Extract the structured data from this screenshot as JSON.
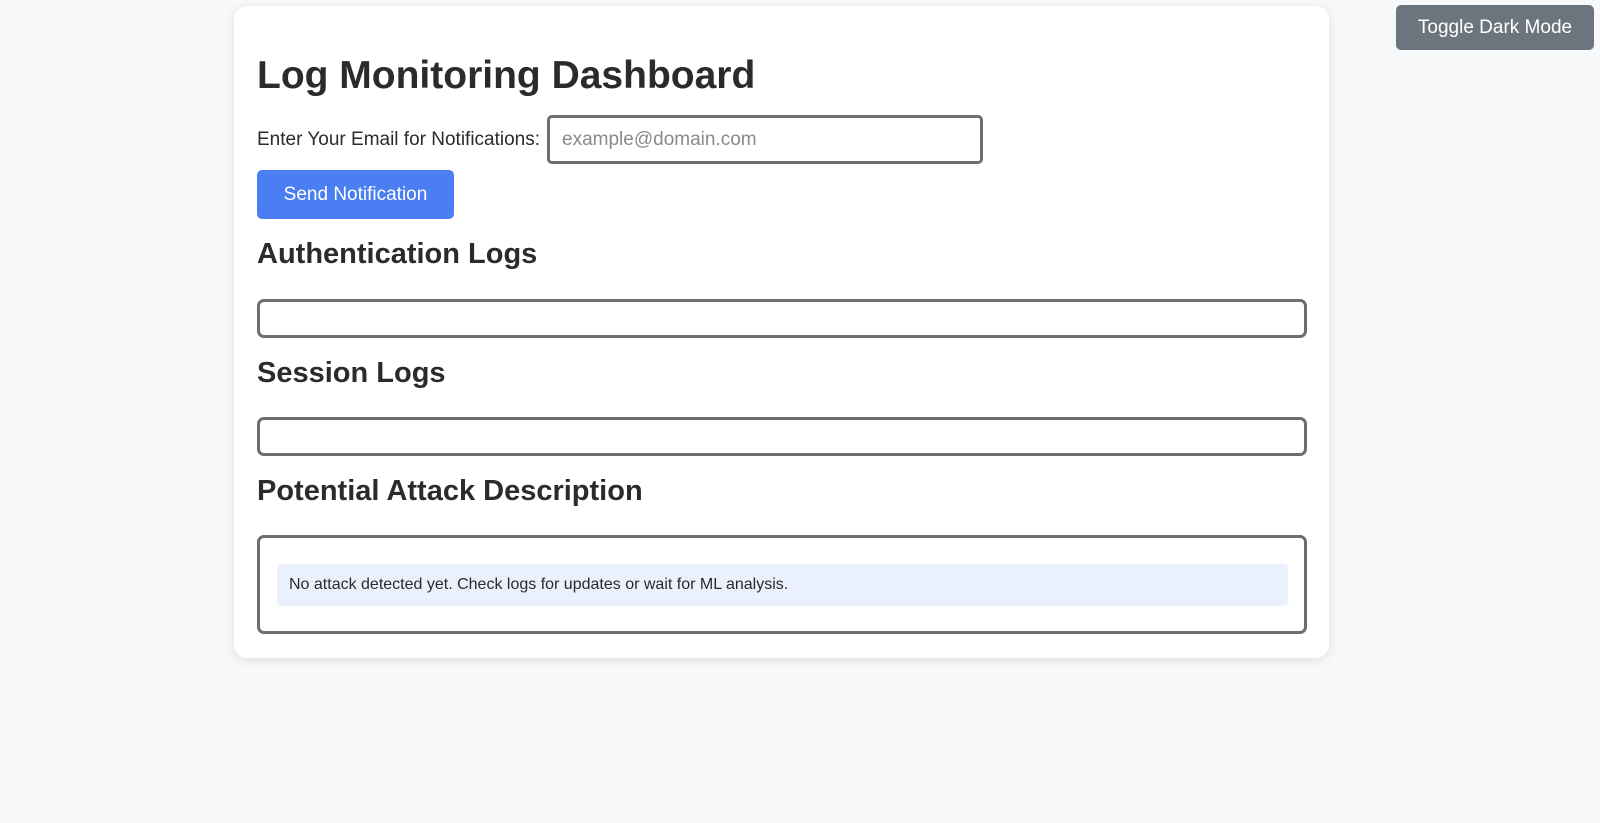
{
  "header": {
    "toggle_dark_mode_label": "Toggle Dark Mode"
  },
  "main": {
    "title": "Log Monitoring Dashboard",
    "email": {
      "label": "Enter Your Email for Notifications:",
      "value": "",
      "placeholder": "example@domain.com"
    },
    "send_button_label": "Send Notification",
    "sections": {
      "auth_logs_title": "Authentication Logs",
      "auth_logs_content": "",
      "session_logs_title": "Session Logs",
      "session_logs_content": "",
      "attack_title": "Potential Attack Description",
      "attack_message": "No attack detected yet. Check logs for updates or wait for ML analysis."
    }
  },
  "colors": {
    "accent": "#4a7ef2",
    "toggle_button": "#6c757d",
    "background": "#f7f8fa",
    "message_bg": "#eaf0fc"
  }
}
